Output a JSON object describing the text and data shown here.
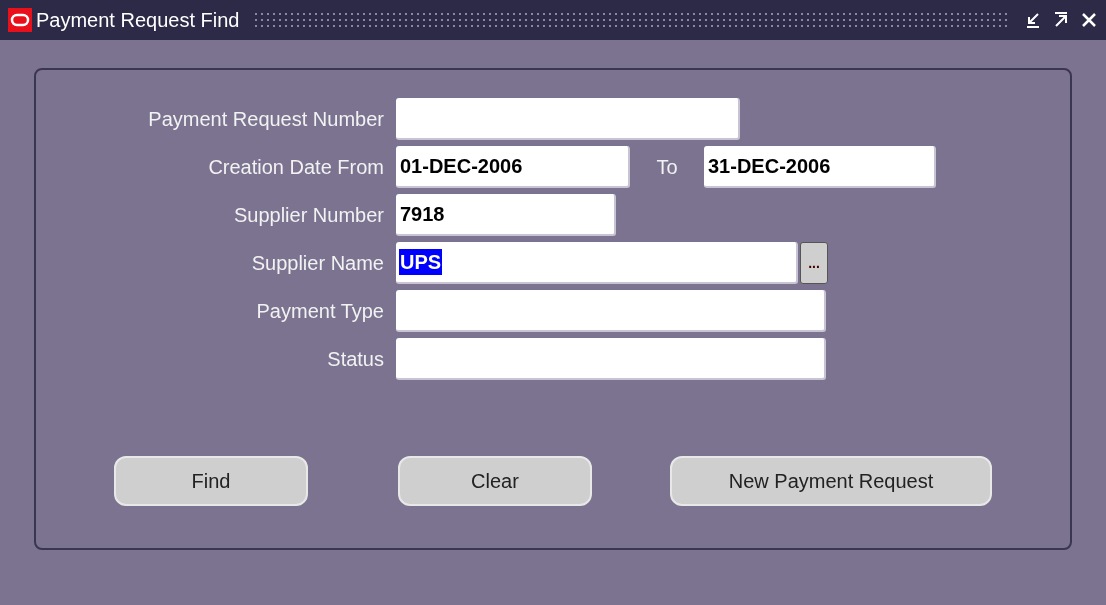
{
  "window": {
    "title": "Payment Request Find"
  },
  "fields": [
    {
      "label": "Payment Request Number"
    },
    {
      "label": "Creation Date From",
      "value": "01-DEC-2006",
      "to": {
        "label": "To",
        "value": "31-DEC-2006"
      }
    },
    {
      "label": "Supplier Number",
      "value": "7918"
    },
    {
      "label": "Supplier Name",
      "value": "UPS",
      "selected": true,
      "lov": "..."
    },
    {
      "label": "Payment Type"
    },
    {
      "label": "Status"
    }
  ],
  "buttons": [
    {
      "label": "Find"
    },
    {
      "label": "Clear"
    },
    {
      "label": "New Payment Request"
    }
  ]
}
